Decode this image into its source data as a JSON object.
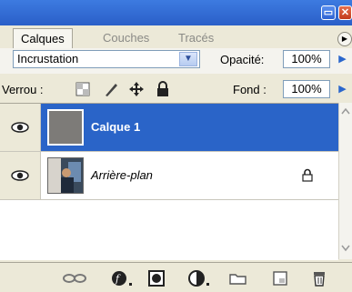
{
  "tabs": [
    "Calques",
    "Couches",
    "Tracés"
  ],
  "blend_mode": "Incrustation",
  "opacity": {
    "label": "Opacité:",
    "value": "100%"
  },
  "lock": {
    "label": "Verrou :"
  },
  "fill": {
    "label": "Fond :",
    "value": "100%"
  },
  "layers": [
    {
      "name": "Calque 1",
      "selected": true,
      "locked": false
    },
    {
      "name": "Arrière-plan",
      "selected": false,
      "locked": true
    }
  ],
  "colors": {
    "selection": "#2a64c8",
    "panel": "#ece9d8",
    "titlebar": "#3d7be0"
  },
  "bottom_icons": [
    "link-icon",
    "layer-style-icon",
    "add-mask-icon",
    "adjustment-layer-icon",
    "new-group-icon",
    "new-layer-icon",
    "delete-layer-icon"
  ]
}
